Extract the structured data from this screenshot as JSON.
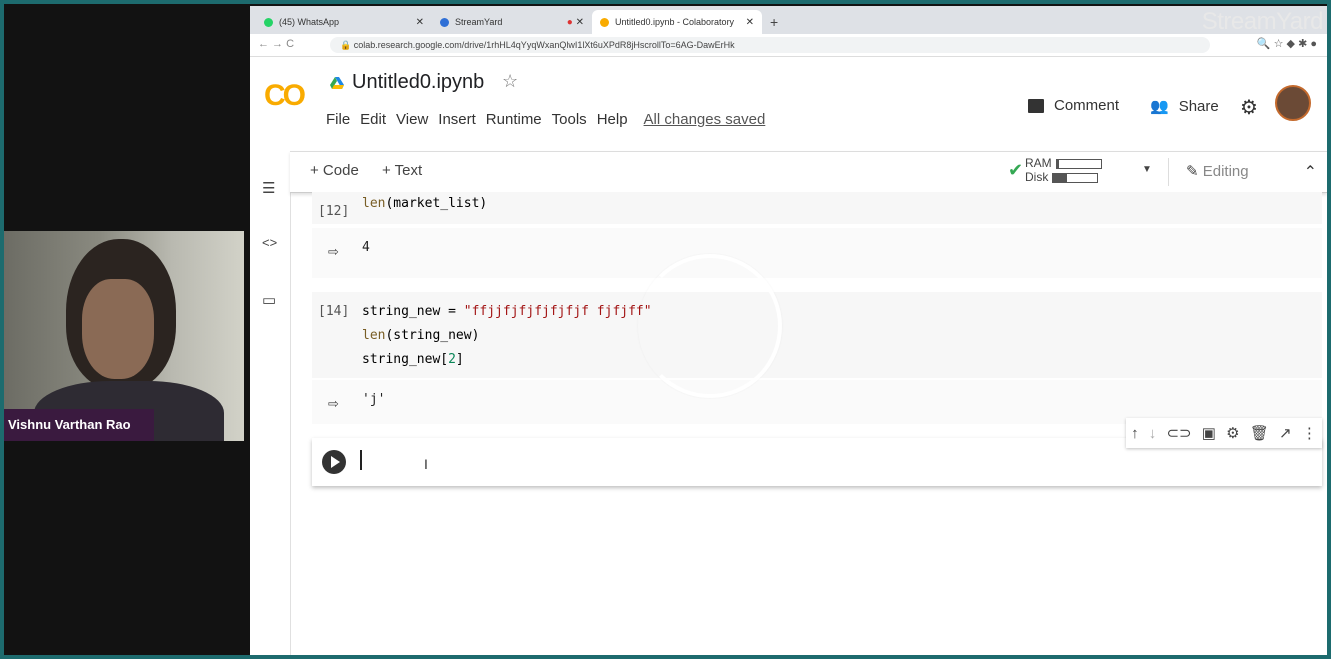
{
  "overlay": {
    "participant_name": "Vishnu Varthan Rao",
    "brand": "StreamYard"
  },
  "browser": {
    "tabs": [
      {
        "label": "(45) WhatsApp",
        "active": false
      },
      {
        "label": "StreamYard",
        "active": false
      },
      {
        "label": "Untitled0.ipynb - Colaboratory",
        "active": true
      }
    ],
    "url": "colab.research.google.com/drive/1rhHL4qYyqWxanQlwI1lXt6uXPdR8jHscrollTo=6AG-DawErHk"
  },
  "colab": {
    "logo": "CO",
    "file_title": "Untitled0.ipynb",
    "menu": [
      "File",
      "Edit",
      "View",
      "Insert",
      "Runtime",
      "Tools",
      "Help"
    ],
    "save_status": "All changes saved",
    "comment_label": "Comment",
    "share_label": "Share",
    "toolbar": {
      "add_code": "+ Code",
      "add_text": "+ Text",
      "ram_label": "RAM",
      "disk_label": "Disk",
      "ram_fraction": 0.05,
      "disk_fraction": 0.3,
      "editing_label": "Editing"
    }
  },
  "cells": {
    "cell1": {
      "prompt": "[12]",
      "line1_fn": "len",
      "line1_rest": "(market_list)",
      "output": "4"
    },
    "cell2": {
      "prompt": "[14]",
      "line1_var": "string_new = ",
      "line1_str": "\"ffjjfjfjfjfjfjf fjfjff\"",
      "line2_fn": "len",
      "line2_rest": "(string_new)",
      "line3_pre": "string_new[",
      "line3_num": "2",
      "line3_post": "]",
      "output": "'j'"
    }
  },
  "icons": {
    "toc": "toc-icon",
    "code_snippets": "code-icon",
    "files": "folder-icon"
  }
}
